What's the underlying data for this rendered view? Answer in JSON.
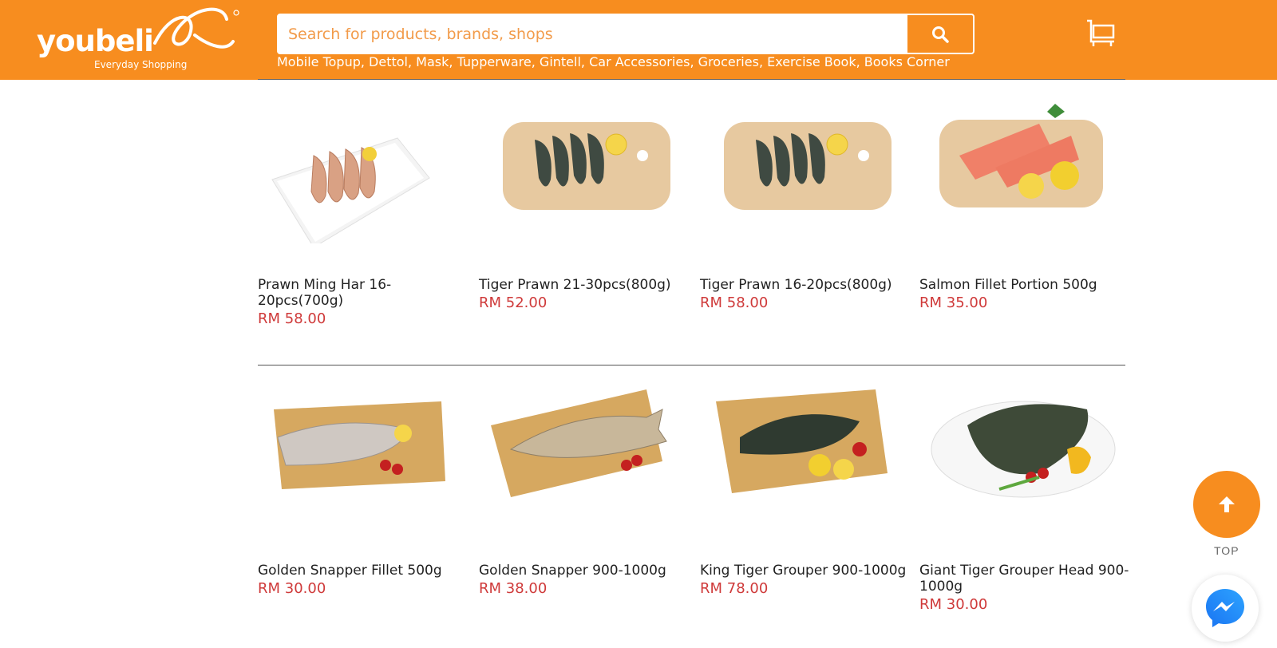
{
  "brand": {
    "name": "youbeli",
    "tagline": "Everyday Shopping",
    "accent": "#f78d1f",
    "price_color": "#cf3a3a"
  },
  "search": {
    "placeholder": "Search for products, brands, shops",
    "value": ""
  },
  "popular_keywords": [
    "Mobile Topup",
    "Dettol",
    "Mask",
    "Tupperware",
    "Gintell",
    "Car Accessories",
    "Groceries",
    "Exercise Book",
    "Books Corner"
  ],
  "products": [
    {
      "name": "Prawn Ming Har 16-20pcs(700g)",
      "price": "RM 58.00",
      "image": "prawns-on-white-plate"
    },
    {
      "name": "Tiger Prawn 21-30pcs(800g)",
      "price": "RM 52.00",
      "image": "tiger-prawns-on-board"
    },
    {
      "name": "Tiger Prawn 16-20pcs(800g)",
      "price": "RM 58.00",
      "image": "tiger-prawns-on-board"
    },
    {
      "name": "Salmon Fillet Portion 500g",
      "price": "RM 35.00",
      "image": "salmon-fillets-on-board"
    },
    {
      "name": "Golden Snapper Fillet 500g",
      "price": "RM 30.00",
      "image": "snapper-fillet-on-board"
    },
    {
      "name": "Golden Snapper 900-1000g",
      "price": "RM 38.00",
      "image": "whole-snapper-on-board"
    },
    {
      "name": "King Tiger Grouper 900-1000g",
      "price": "RM 78.00",
      "image": "grouper-on-board"
    },
    {
      "name": "Giant Tiger Grouper Head 900-1000g",
      "price": "RM 30.00",
      "image": "grouper-head-on-plate"
    }
  ],
  "floating": {
    "top_label": "TOP",
    "top_icon": "arrow-up-icon",
    "chat_icon": "messenger-icon"
  }
}
